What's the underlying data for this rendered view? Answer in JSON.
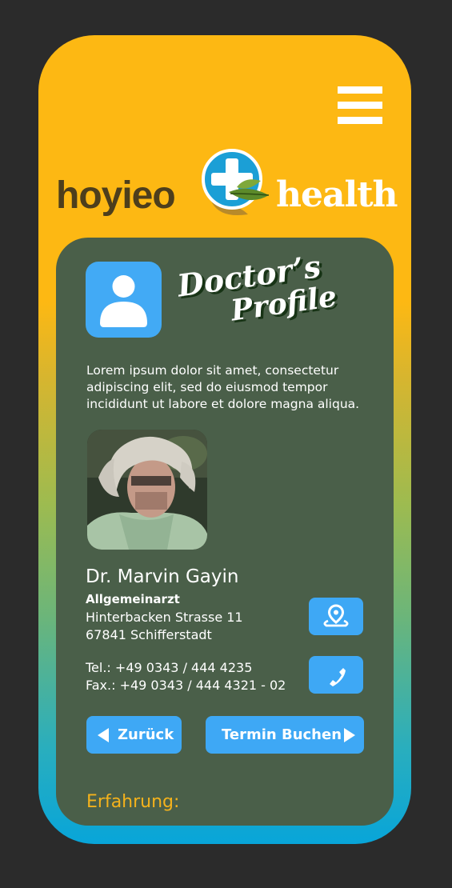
{
  "header": {
    "logo_left": "hoyieo",
    "logo_right": "health"
  },
  "profile": {
    "title_line1": "Doctor’s",
    "title_line2": "Profile",
    "intro": "Lorem ipsum dolor sit amet, consectetur adipiscing elit, sed do eiusmod tempor incididunt ut labore et dolore magna aliqua.",
    "name": "Dr. Marvin Gayin",
    "role": "Allgemeinarzt",
    "street": "Hinterbacken Strasse 11",
    "city": "67841 Schifferstadt",
    "phone": "Tel.: +49 0343 / 444 4235",
    "fax": "Fax.: +49 0343 / 444 4321 - 02"
  },
  "buttons": {
    "back_label": "Zurück",
    "book_label": "Termin Buchen"
  },
  "sections": {
    "experience_heading": "Erfahrung:"
  },
  "colors": {
    "brand_yellow": "#fdb813",
    "card_green": "#4a5f49",
    "accent_blue": "#3ea8f5",
    "heading_orange": "#f4b21c"
  },
  "icons": {
    "menu": "hamburger-menu-icon",
    "profile": "user-icon",
    "location": "map-pin-icon",
    "phone": "phone-icon",
    "back": "triangle-left-icon",
    "forward": "triangle-right-icon"
  }
}
